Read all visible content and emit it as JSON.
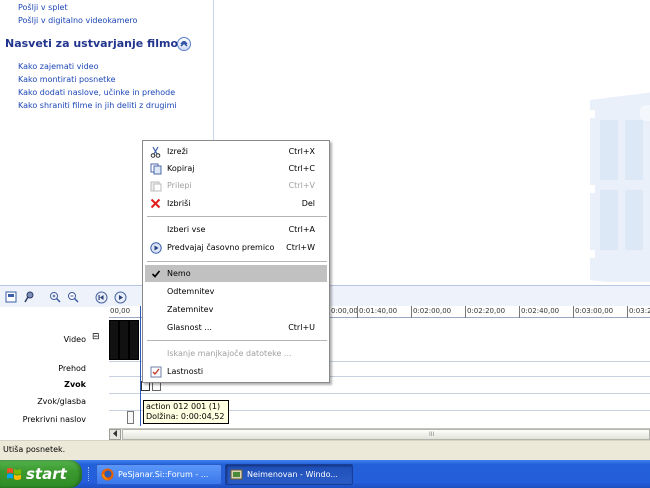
{
  "task_pane": {
    "top_links": [
      "Pošlji v splet",
      "Pošlji v digitalno videokamero"
    ],
    "section_title": "Nasveti za ustvarjanje filmov",
    "links": [
      "Kako zajemati video",
      "Kako montirati posnetke",
      "Kako dodati naslove, učinke in prehode",
      "Kako shraniti filme in jih deliti z drugimi"
    ]
  },
  "context_menu": {
    "items": [
      {
        "label": "Izreži",
        "shortcut": "Ctrl+X",
        "icon": "scissors-icon"
      },
      {
        "label": "Kopiraj",
        "shortcut": "Ctrl+C",
        "icon": "copy-icon"
      },
      {
        "label": "Prilepi",
        "shortcut": "Ctrl+V",
        "icon": "paste-icon"
      },
      {
        "label": "Izbriši",
        "shortcut": "Del",
        "icon": "delete-x-icon"
      },
      {
        "label": "Izberi vse",
        "shortcut": "Ctrl+A"
      },
      {
        "label": "Predvajaj časovno premico",
        "shortcut": "Ctrl+W",
        "icon": "play-circle-icon"
      },
      {
        "label": "Nemo",
        "icon": "checkmark-icon"
      },
      {
        "label": "Odtemnitev"
      },
      {
        "label": "Zatemnitev"
      },
      {
        "label": "Glasnost ...",
        "shortcut": "Ctrl+U"
      },
      {
        "label": "Iskanje manjkajoče datoteke ..."
      },
      {
        "label": "Lastnosti",
        "icon": "properties-icon"
      }
    ]
  },
  "timeline": {
    "ruler_ticks": [
      "00,00",
      "0:00,00",
      "0:01:40,00",
      "0:02:00,00",
      "0:02:20,00",
      "0:02:40,00",
      "0:03:00,00",
      "0:03:2"
    ],
    "track_labels": {
      "video": "Video",
      "transition": "Prehod",
      "audio": "Zvok",
      "music": "Zvok/glasba",
      "title_overlay": "Prekrivni naslov"
    },
    "expand_symbol": "⊟",
    "tooltip": {
      "line1": "action 012 001 (1)",
      "line2": "Dolžina:  0:00:04,52"
    },
    "scroll_grip": "III"
  },
  "status_bar": {
    "text": "Utiša posnetek."
  },
  "taskbar": {
    "start_label": "start",
    "tasks": [
      "PeSjanar.Si::Forum - ...",
      "Neimenovan - Windo..."
    ]
  },
  "colors": {
    "link": "#1c47b6",
    "heading": "#22358e",
    "menu_highlight": "#c1c1c1",
    "taskbar": "#245edb",
    "start_green": "#3b9a2f"
  }
}
